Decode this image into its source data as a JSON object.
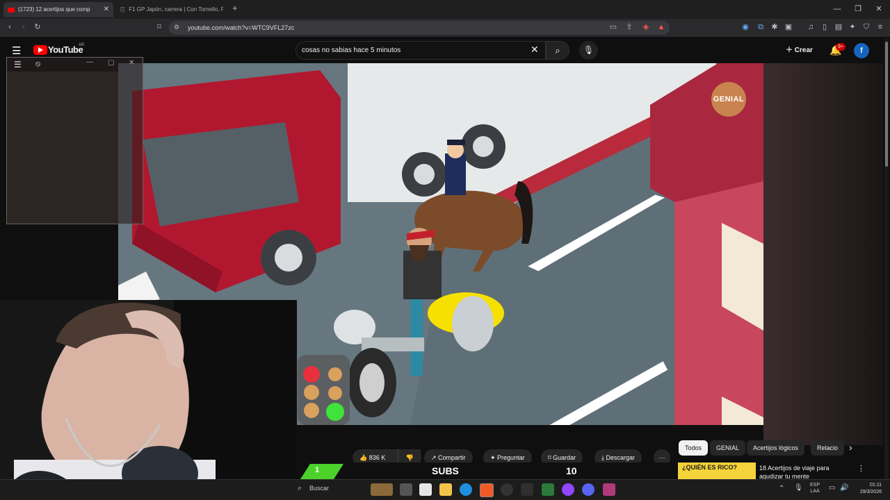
{
  "browser": {
    "tabs": [
      {
        "title": "(1723) 12 acertijos que comp",
        "active": true
      },
      {
        "title": "F1 GP Japón, carrera | Con Tornello, F",
        "active": false
      }
    ],
    "url": "youtube.com/watch?v=WTC9VFL27zc"
  },
  "youtube": {
    "logo_text": "YouTube",
    "region": "AR",
    "search_value": "cosas no sabias hace 5 minutos",
    "create_label": "Crear",
    "notif_count": "9+",
    "avatar_letter": "f"
  },
  "video": {
    "watermark": "GENIAL"
  },
  "actions": {
    "likes": "836 K",
    "share": "Compartir",
    "ask": "Preguntar",
    "save": "Guardar",
    "download": "Descargar"
  },
  "chips": [
    "Todos",
    "GENIAL",
    "Acertijos lógicos",
    "Relacio"
  ],
  "recommendation": {
    "thumb_text": "¿QUIÉN ES RICO?",
    "title": "18 Acertijos de viaje para agudizar tu mente"
  },
  "stream_overlay": {
    "counter_left": "1",
    "subs_label": "SUBS",
    "counter_right": "10"
  },
  "taskbar": {
    "search": "Buscar",
    "lang1": "ESP",
    "lang2": "LAA",
    "time": "01:11",
    "date": "29/3/2026"
  },
  "colors": {
    "yt_red": "#ff0000",
    "accent_blue": "#3ea6ff",
    "green": "#4cd12b"
  }
}
